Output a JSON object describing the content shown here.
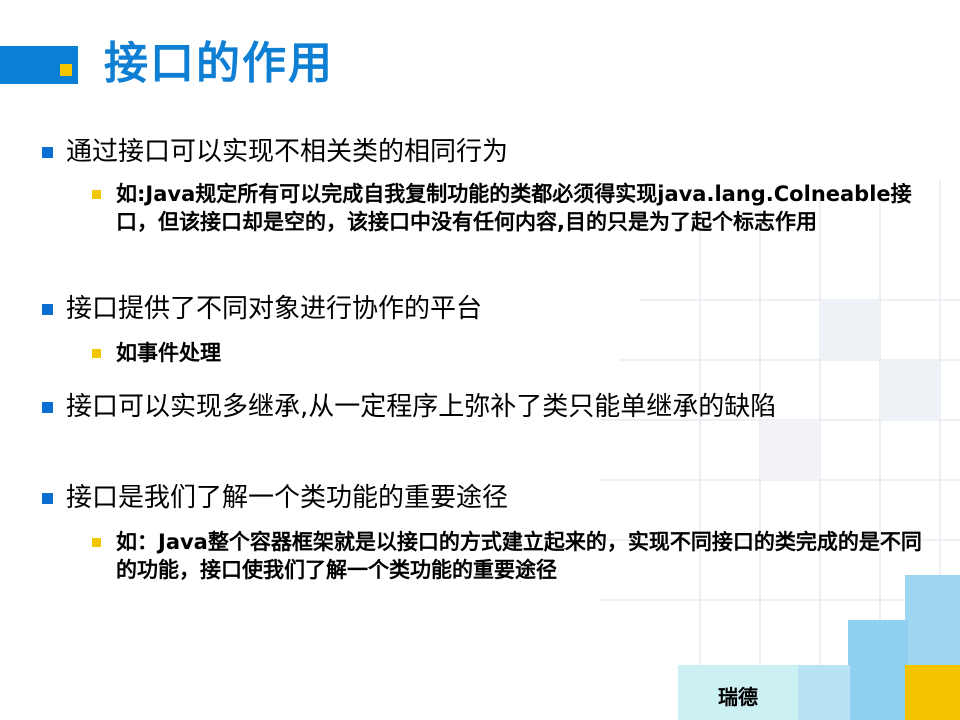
{
  "slide": {
    "title": "接口的作用",
    "bullets": [
      {
        "text": "通过接口可以实现不相关类的相同行为",
        "sub": [
          "如:Java规定所有可以完成自我复制功能的类都必须得实现java.lang.Colneable接口，但该接口却是空的，该接口中没有任何内容,目的只是为了起个标志作用"
        ]
      },
      {
        "text": "接口提供了不同对象进行协作的平台",
        "sub": [
          "如事件处理"
        ]
      },
      {
        "text": "接口可以实现多继承,从一定程序上弥补了类只能单继承的缺陷",
        "sub": []
      },
      {
        "text": "接口是我们了解一个类功能的重要途径",
        "sub": [
          "如：Java整个容器框架就是以接口的方式建立起来的，实现不同接口的类完成的是不同的功能，接口使我们了解一个类功能的重要途径"
        ]
      }
    ],
    "footer": "瑞德"
  },
  "colors": {
    "accent_blue": "#0a7fd6",
    "title_blue": "#0f7fd3",
    "accent_yellow": "#f7c400",
    "footer_cyan": "#ccf1f3"
  }
}
